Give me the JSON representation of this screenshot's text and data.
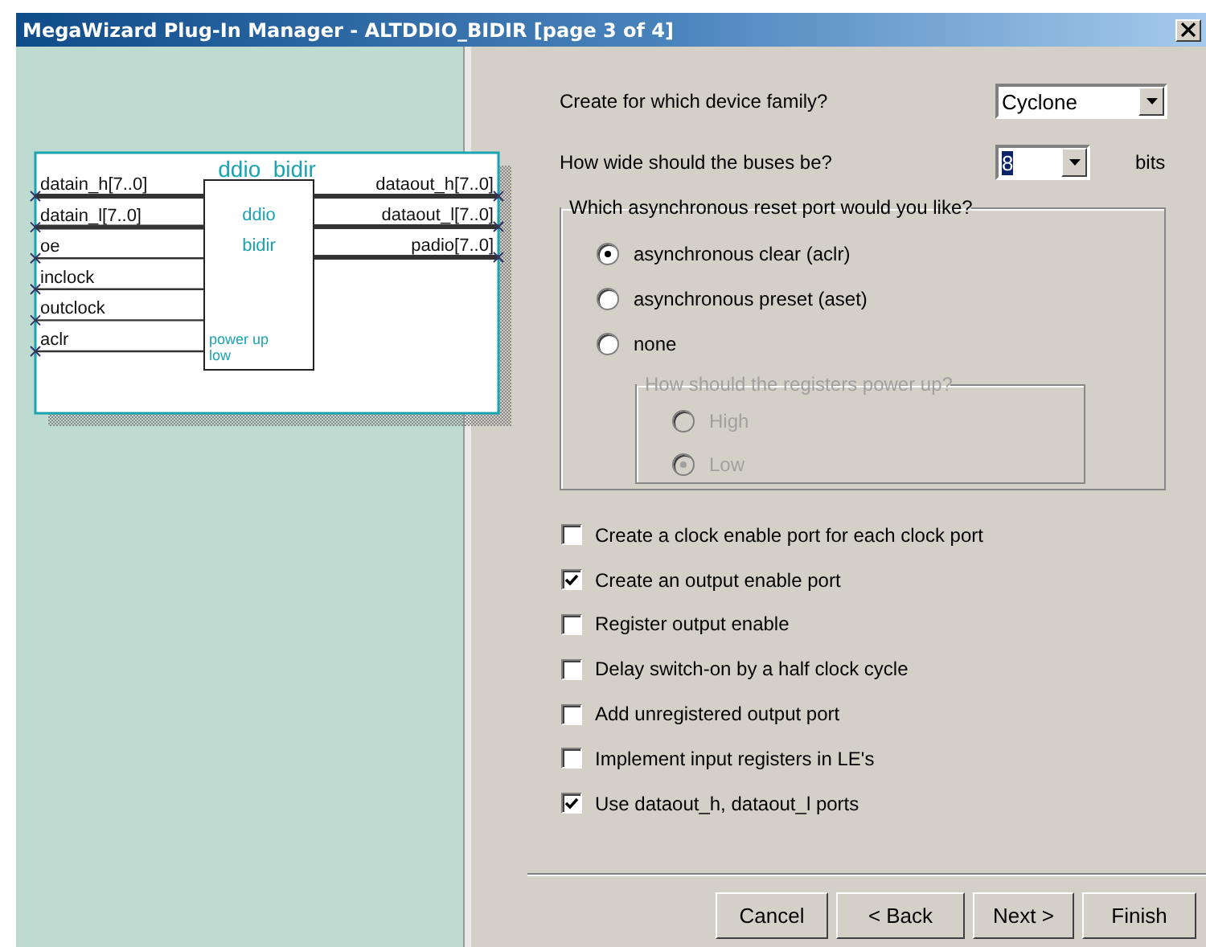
{
  "window": {
    "title": "MegaWizard Plug-In Manager - ALTDDIO_BIDIR [page 3 of 4]"
  },
  "symbol": {
    "name": "ddio_bidir",
    "block_lines": [
      "ddio",
      "bidir"
    ],
    "note_lines": [
      "power up",
      "low"
    ],
    "inputs": [
      {
        "label": "datain_h[7..0]",
        "bus": true
      },
      {
        "label": "datain_l[7..0]",
        "bus": true
      },
      {
        "label": "oe",
        "bus": false
      },
      {
        "label": "inclock",
        "bus": false
      },
      {
        "label": "outclock",
        "bus": false
      },
      {
        "label": "aclr",
        "bus": false
      }
    ],
    "outputs": [
      {
        "label": "dataout_h[7..0]",
        "bus": true
      },
      {
        "label": "dataout_l[7..0]",
        "bus": true
      },
      {
        "label": "padio[7..0]",
        "bus": true
      }
    ]
  },
  "device_family": {
    "label": "Create for which device family?",
    "value": "Cyclone"
  },
  "bus_width": {
    "label": "How wide should the buses be?",
    "value": "8",
    "unit": "bits"
  },
  "reset_group": {
    "title": "Which asynchronous reset port would you like?",
    "disabled": false,
    "options": [
      {
        "label": "asynchronous clear (aclr)",
        "selected": true
      },
      {
        "label": "asynchronous preset (aset)",
        "selected": false
      },
      {
        "label": "none",
        "selected": false
      }
    ]
  },
  "power_up_group": {
    "title": "How should the registers power up?",
    "disabled": true,
    "options": [
      {
        "label": "High",
        "selected": false
      },
      {
        "label": "Low",
        "selected": true
      }
    ]
  },
  "checkboxes": [
    {
      "label": "Create a clock enable port for each clock port",
      "checked": false
    },
    {
      "label": "Create an output enable port",
      "checked": true
    },
    {
      "label": "Register output enable",
      "checked": false
    },
    {
      "label": "Delay switch-on by a half clock cycle",
      "checked": false
    },
    {
      "label": "Add unregistered output port",
      "checked": false
    },
    {
      "label": "Implement input registers in LE's",
      "checked": false
    },
    {
      "label": "Use dataout_h, dataout_l ports",
      "checked": true
    }
  ],
  "buttons": [
    "Cancel",
    "< Back",
    "Next >",
    "Finish"
  ]
}
